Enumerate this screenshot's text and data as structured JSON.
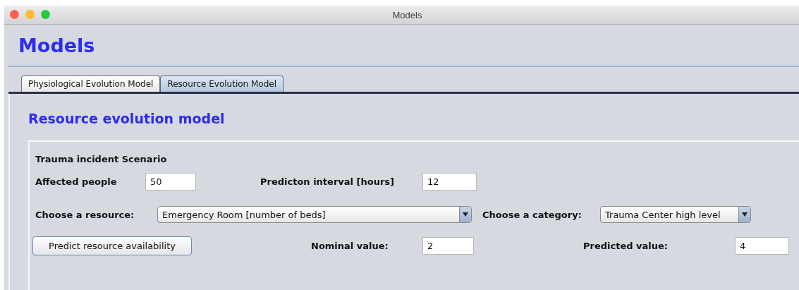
{
  "window": {
    "title": "Models"
  },
  "heading": "Models",
  "tabs": [
    {
      "label": "Physiological Evolution Model",
      "selected": false
    },
    {
      "label": "Resource Evolution Model",
      "selected": true
    }
  ],
  "panel": {
    "title": "Resource evolution model",
    "scenario": {
      "title": "Trauma incident Scenario",
      "affected_people": {
        "label": "Affected people",
        "value": "50"
      },
      "prediction_interval": {
        "label": "Predicton interval [hours]",
        "value": "12"
      },
      "resource": {
        "label": "Choose a resource:",
        "value": "Emergency Room [number of beds]"
      },
      "category": {
        "label": "Choose a category:",
        "value": "Trauma Center high level"
      },
      "predict_button": "Predict resource availability",
      "nominal_value": {
        "label": "Nominal value:",
        "value": "2"
      },
      "predicted_value": {
        "label": "Predicted value:",
        "value": "4"
      }
    }
  }
}
